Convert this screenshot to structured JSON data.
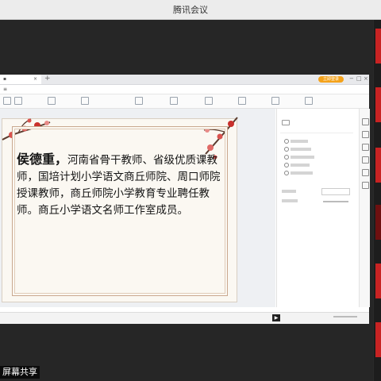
{
  "window": {
    "title": "腾讯会议"
  },
  "screen_share": {
    "label": "屏幕共享"
  },
  "app": {
    "upgrade_pill": "立即登录",
    "add_tab": "+",
    "window_controls": [
      "−",
      "□",
      "×"
    ]
  },
  "slide": {
    "name": "侯德重，",
    "body": "河南省骨干教师、省级优质课教师，国培计划小学语文商丘师院、周口师院授课教师，商丘师院小学教育专业聘任教师。商丘小学语文名师工作室成员。"
  },
  "colors": {
    "accent_red": "#c82323",
    "pill": "#f4a21a",
    "meeting_bg": "#262626"
  },
  "icons": [
    "close-icon",
    "play-icon",
    "plus-icon"
  ]
}
